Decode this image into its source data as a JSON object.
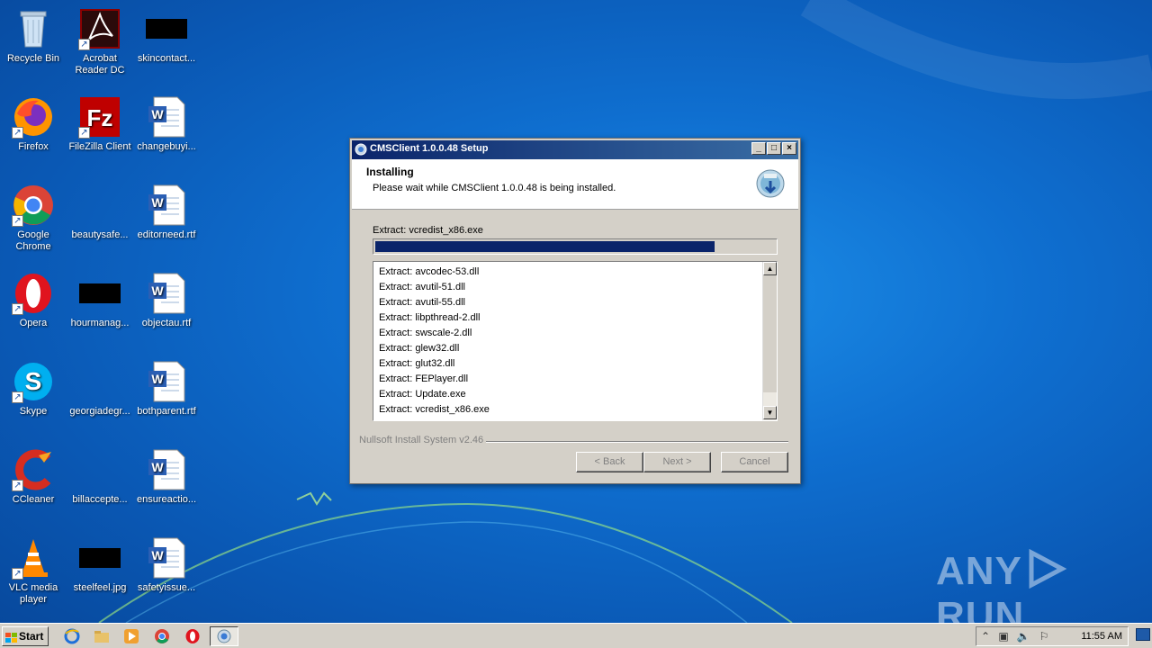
{
  "desktop": {
    "icons": [
      {
        "label": "Recycle Bin"
      },
      {
        "label": "Acrobat Reader DC"
      },
      {
        "label": "skincontact..."
      },
      {
        "label": "Firefox"
      },
      {
        "label": "FileZilla Client"
      },
      {
        "label": "changebuyi..."
      },
      {
        "label": "Google Chrome"
      },
      {
        "label": "beautysafe..."
      },
      {
        "label": "editorneed.rtf"
      },
      {
        "label": "Opera"
      },
      {
        "label": "hourmanag..."
      },
      {
        "label": "objectau.rtf"
      },
      {
        "label": "Skype"
      },
      {
        "label": "georgiadegr..."
      },
      {
        "label": "bothparent.rtf"
      },
      {
        "label": "CCleaner"
      },
      {
        "label": "billaccepte..."
      },
      {
        "label": "ensureactio..."
      },
      {
        "label": "VLC media player"
      },
      {
        "label": "steelfeel.jpg"
      },
      {
        "label": "safetyissue..."
      }
    ]
  },
  "dialog": {
    "title": "CMSClient 1.0.0.48 Setup",
    "header_title": "Installing",
    "header_subtitle": "Please wait while CMSClient 1.0.0.48 is being installed.",
    "status": "Extract: vcredist_x86.exe",
    "progress_percent": 85,
    "log_lines": [
      "Extract: avcodec-53.dll",
      "Extract: avutil-51.dll",
      "Extract: avutil-55.dll",
      "Extract: libpthread-2.dll",
      "Extract: swscale-2.dll",
      "Extract: glew32.dll",
      "Extract: glut32.dll",
      "Extract: FEPlayer.dll",
      "Extract: Update.exe",
      "Extract: vcredist_x86.exe"
    ],
    "branding": "Nullsoft Install System v2.46",
    "back_label": "< Back",
    "next_label": "Next >",
    "cancel_label": "Cancel"
  },
  "taskbar": {
    "start_label": "Start",
    "clock": "11:55 AM"
  },
  "watermark": {
    "left": "ANY",
    "right": "RUN"
  }
}
